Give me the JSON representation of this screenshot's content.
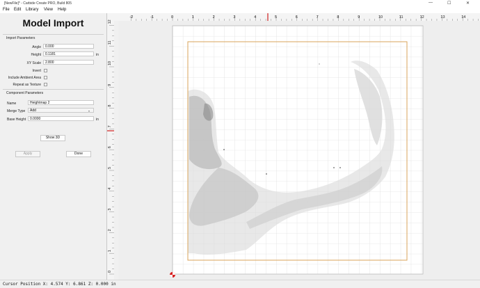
{
  "window": {
    "title": "[NewFile]* - Carbide Create PRO, Build 805",
    "minimize": "—",
    "maximize": "☐",
    "close": "✕"
  },
  "menu": {
    "file": "File",
    "edit": "Edit",
    "library": "Library",
    "view": "View",
    "help": "Help"
  },
  "panel": {
    "title": "Model Import",
    "import_section": "Import Parameters",
    "angle_label": "Angle",
    "angle_value": "0.000",
    "height_label": "Height",
    "height_value": "0.1181",
    "height_unit": "in",
    "xyscale_label": "XY Scale",
    "xyscale_value": "2.800",
    "invert_label": "Invert",
    "invert_checked": false,
    "ambient_label": "Include Ambient Area",
    "ambient_checked": false,
    "repeat_label": "Repeat as Texture",
    "repeat_checked": false,
    "component_section": "Component Parameters",
    "name_label": "Name",
    "name_value": "Heightmap 2",
    "merge_label": "Merge Type",
    "merge_value": "Add",
    "base_label": "Base Height",
    "base_value": "0.0000",
    "base_unit": "in",
    "show3d_button": "Show 3D",
    "apply_button": "Apply",
    "done_button": "Done"
  },
  "ruler": {
    "x_ticks": [
      "-2",
      "-1",
      "0",
      "1",
      "2",
      "3",
      "4",
      "5",
      "6",
      "7",
      "8",
      "9",
      "10",
      "11",
      "12",
      "13",
      "14"
    ],
    "y_ticks": [
      "0",
      "1",
      "2",
      "3",
      "4",
      "5",
      "6",
      "7",
      "8",
      "9",
      "10",
      "11",
      "12"
    ],
    "cursor_x": 4.574,
    "cursor_y": 6.861
  },
  "status": {
    "text": "Cursor Position X: 4.574 Y: 6.861 Z: 0.000 in"
  },
  "colors": {
    "stock_outline": "#d9a35a",
    "cursor_marker": "#d02020",
    "grid_line": "#d6d6d6",
    "origin_marker": "#d62020"
  }
}
